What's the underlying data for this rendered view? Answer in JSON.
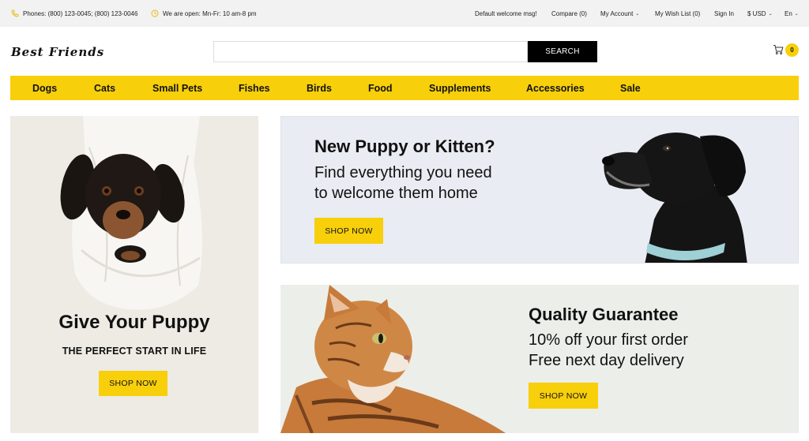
{
  "topbar": {
    "phones": "Phones: (800) 123-0045; (800) 123-0046",
    "hours": "We are open: Mn-Fr: 10 am-8 pm",
    "welcome": "Default welcome msg!",
    "compare": "Compare (0)",
    "account": "My Account",
    "wishlist": "My Wish List (0)",
    "signin": "Sign In",
    "currency": "$ USD",
    "language": "En"
  },
  "header": {
    "logo": "Best Friends",
    "search_button": "SEARCH",
    "search_value": "",
    "cart_count": "0"
  },
  "nav": {
    "items": [
      "Dogs",
      "Cats",
      "Small Pets",
      "Fishes",
      "Birds",
      "Food",
      "Supplements",
      "Accessories",
      "Sale"
    ]
  },
  "promo_left": {
    "title": "Give Your Puppy",
    "subtitle": "THE PERFECT START IN LIFE",
    "button": "SHOP NOW"
  },
  "promo_top": {
    "title": "New Puppy or Kitten?",
    "line1": "Find everything you need",
    "line2": "to welcome them home",
    "button": "SHOP NOW"
  },
  "promo_bottom": {
    "title": "Quality Guarantee",
    "line1": "10% off your first order",
    "line2": "Free next day delivery",
    "button": "SHOP NOW"
  },
  "colors": {
    "accent": "#f7cf0b",
    "topbar_bg": "#f2f2f2",
    "button_dark": "#000000"
  },
  "icons": [
    "phone-icon",
    "clock-icon",
    "cart-icon",
    "chevron-down-icon"
  ]
}
